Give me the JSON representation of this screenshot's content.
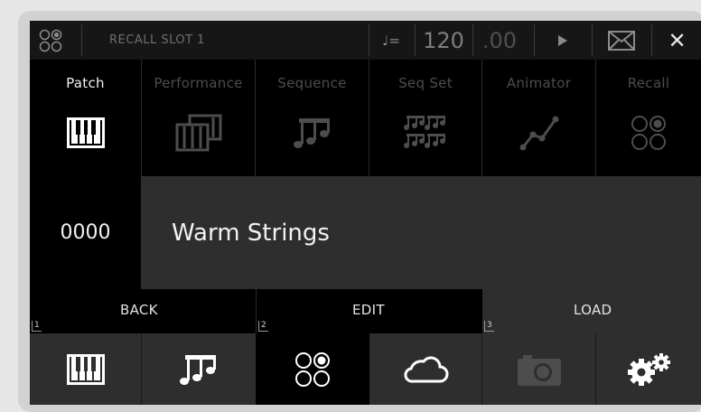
{
  "topbar": {
    "slot_title": "RECALL SLOT 1",
    "tempo_icon": "♩=",
    "tempo_integer": "120",
    "tempo_decimal": ".00",
    "close_label": "✕"
  },
  "modes": [
    {
      "label": "Patch",
      "icon": "keyboard-icon",
      "active": true
    },
    {
      "label": "Performance",
      "icon": "stacked-keyboards-icon",
      "active": false
    },
    {
      "label": "Sequence",
      "icon": "music-notes-icon",
      "active": false
    },
    {
      "label": "Seq Set",
      "icon": "sequence-set-icon",
      "active": false
    },
    {
      "label": "Animator",
      "icon": "animator-curve-icon",
      "active": false
    },
    {
      "label": "Recall",
      "icon": "recall-circles-icon",
      "active": false
    }
  ],
  "patch": {
    "number": "0000",
    "name": "Warm Strings"
  },
  "actions": [
    {
      "num": "1",
      "label": "BACK"
    },
    {
      "num": "2",
      "label": "EDIT"
    },
    {
      "num": "3",
      "label": "LOAD"
    }
  ],
  "bottom": [
    {
      "icon": "keyboard-icon",
      "active": false
    },
    {
      "icon": "music-notes-icon",
      "active": false
    },
    {
      "icon": "recall-circles-icon",
      "active": true
    },
    {
      "icon": "cloud-icon",
      "active": false
    },
    {
      "icon": "camera-icon",
      "active": false
    },
    {
      "icon": "gears-icon",
      "active": false
    }
  ],
  "colors": {
    "background": "#000000",
    "panel": "#2e2e2e",
    "bar": "#161616",
    "active_text": "#f0f0f0",
    "inactive_text": "#4d4d4d",
    "bezel": "#d2d2d2"
  }
}
